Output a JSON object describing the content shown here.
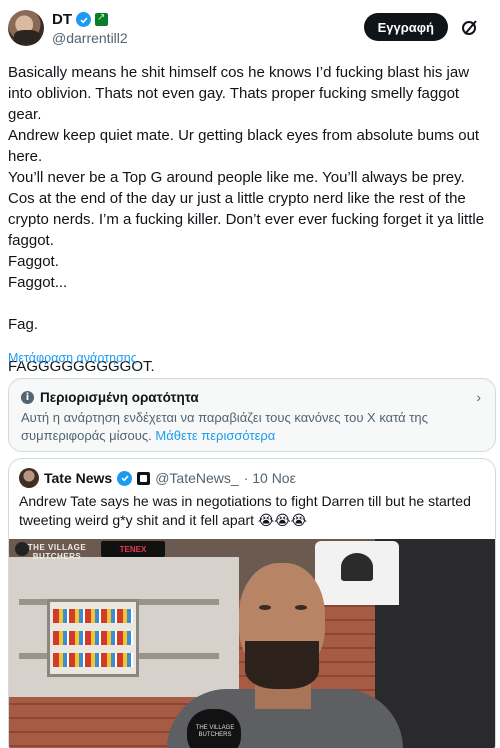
{
  "author": {
    "display_name": "DT",
    "handle": "@darrentill2"
  },
  "header": {
    "signup_label": "Εγγραφή",
    "grok_icon": "grok-icon"
  },
  "tweet": {
    "lines": [
      "Basically means he shit himself cos he knows I’d fucking blast his jaw into oblivion. Thats not even gay. Thats proper fucking smelly faggot gear.",
      "Andrew keep quiet mate. Ur getting black eyes from absolute bums out here.",
      "You’ll never be a Top G around people like me. You’ll always be prey. Cos at the end of the day ur just a little crypto nerd like the rest of the crypto nerds. I’m a fucking killer. Don’t ever ever fucking forget it ya little faggot.",
      "Faggot.",
      "Faggot...",
      "",
      "Fag.",
      "",
      "FAGGGGGGGGGOT."
    ],
    "translate_label": "Μετάφραση ανάρτησης"
  },
  "notice": {
    "title": "Περιορισμένη ορατότητα",
    "body": "Αυτή η ανάρτηση ενδέχεται να παραβιάζει τους κανόνες του X κατά της συμπεριφοράς μίσους.",
    "link": "Μάθετε περισσότερα"
  },
  "quote": {
    "name": "Tate News",
    "handle": "@TateNews_",
    "date": "· 10 Νοε",
    "text": "Andrew Tate says he was in negotiations to fight Darren till but he started tweeting weird g*y shit and it fell apart 😭😭😭",
    "video": {
      "logo_text": "THE VILLAGE BUTCHERS",
      "sponsor_text": "TENEX",
      "mic_text": "THE VILLAGE BUTCHERS"
    }
  },
  "colors": {
    "accent": "#1d9bf0",
    "text": "#0f1419",
    "muted": "#536471",
    "border": "#cfd9de"
  }
}
